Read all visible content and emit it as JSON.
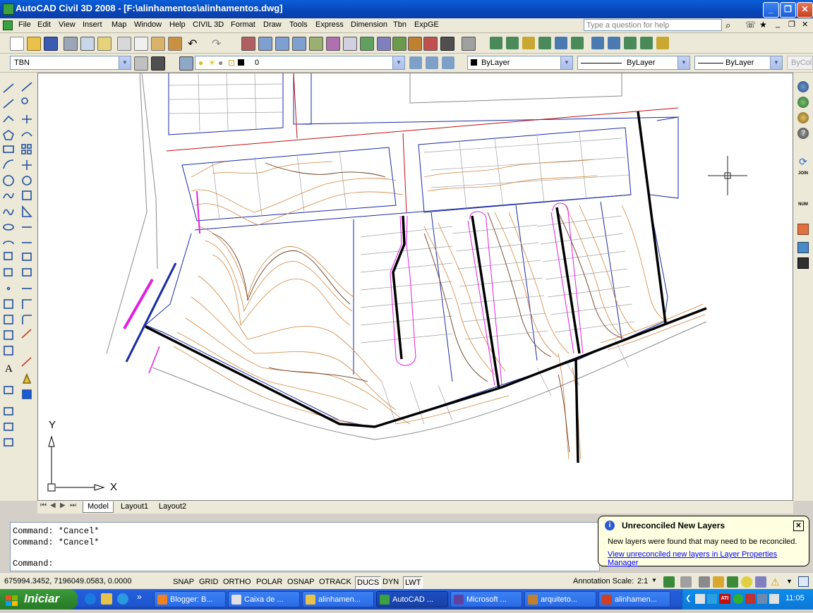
{
  "window": {
    "title": "AutoCAD Civil 3D 2008 - [F:\\alinhamentos\\alinhamentos.dwg]"
  },
  "menu": {
    "items": [
      "File",
      "Edit",
      "View",
      "Insert",
      "Map",
      "Window",
      "Help",
      "CIVIL 3D",
      "Format",
      "Draw",
      "Tools",
      "Express",
      "Dimension",
      "Tbn",
      "ExpGE"
    ],
    "help_placeholder": "Type a question for help"
  },
  "properties_bar": {
    "textstyle": "TBN",
    "layer": "0",
    "color": "ByLayer",
    "linetype": "ByLayer",
    "lineweight": "ByLayer",
    "plotstyle": "ByCol"
  },
  "drawing": {
    "ucs_y": "Y",
    "ucs_x": "X"
  },
  "tabs": [
    "Model",
    "Layout1",
    "Layout2"
  ],
  "command_line": {
    "history": [
      "Command: *Cancel*",
      "Command: *Cancel*"
    ],
    "prompt": "Command:"
  },
  "balloon": {
    "title": "Unreconciled New Layers",
    "message": "New layers were found that may need to be reconciled.",
    "link": "View unreconciled new layers in Layer Properties Manager"
  },
  "status": {
    "coordinates": "675994.3452, 7196049.0583, 0.0000",
    "toggles": [
      {
        "label": "SNAP",
        "on": false
      },
      {
        "label": "GRID",
        "on": false
      },
      {
        "label": "ORTHO",
        "on": false
      },
      {
        "label": "POLAR",
        "on": false
      },
      {
        "label": "OSNAP",
        "on": false
      },
      {
        "label": "OTRACK",
        "on": false
      },
      {
        "label": "DUCS",
        "on": true
      },
      {
        "label": "DYN",
        "on": false
      },
      {
        "label": "LWT",
        "on": true
      }
    ],
    "annotation_scale_label": "Annotation Scale:",
    "annotation_scale_value": "2:1"
  },
  "taskbar": {
    "start_label": "Iniciar",
    "tasks": [
      "Blogger: B...",
      "Caixa de ...",
      "alinhamen...",
      "AutoCAD ...",
      "Microsoft ...",
      "arquiteto...",
      "alinhamen..."
    ],
    "clock": "11:05"
  },
  "colors": {
    "titlebar": "#0a5fd8",
    "contour": "#d2843c",
    "lot_line": "#1a2aa0",
    "road_edge": "#c01010",
    "alignment": "#000000",
    "magenta": "#e020e0"
  }
}
